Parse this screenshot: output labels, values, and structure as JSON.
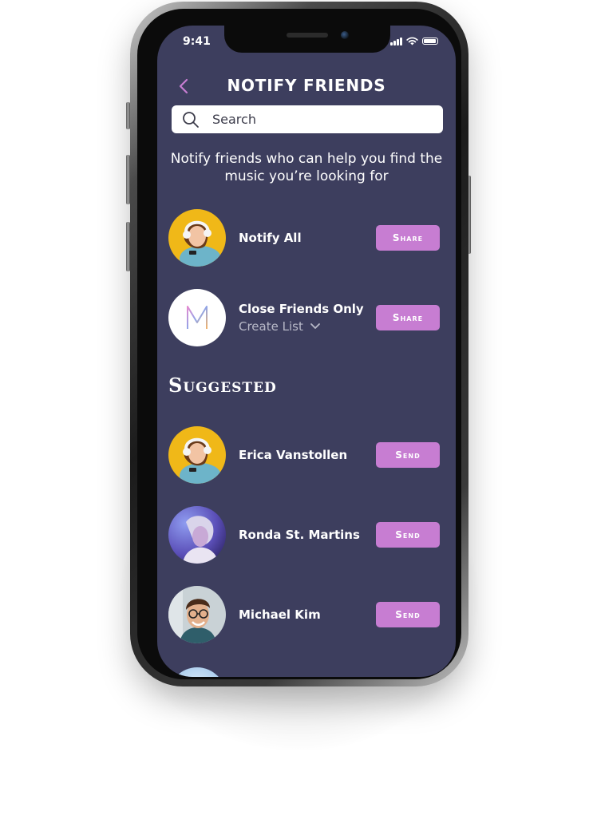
{
  "status_bar": {
    "time": "9:41",
    "icons": [
      "signal-icon",
      "wifi-icon",
      "battery-icon"
    ]
  },
  "header": {
    "title": "NOTIFY FRIENDS",
    "back_icon": "chevron-left-icon"
  },
  "search": {
    "placeholder": "Search",
    "icon": "search-icon"
  },
  "subtitle": "Notify friends who can help you find the music you’re looking for",
  "share_rows": [
    {
      "name": "Notify All",
      "button": "Share",
      "avatar": "woman-with-headphones-yellow"
    },
    {
      "name": "Close Friends Only",
      "sub": "Create List",
      "button": "Share",
      "avatar": "m-logo"
    }
  ],
  "suggested": {
    "title": "Suggested",
    "items": [
      {
        "name": "Erica Vanstollen",
        "button": "Send",
        "avatar": "woman-with-headphones-yellow"
      },
      {
        "name": "Ronda St. Martins",
        "button": "Send",
        "avatar": "woman-purple-light"
      },
      {
        "name": "Michael Kim",
        "button": "Send",
        "avatar": "man-with-glasses"
      }
    ]
  },
  "colors": {
    "screen_bg": "#3d3e5e",
    "accent": "#c77dd2",
    "text": "#ffffff",
    "muted_text": "#b8b9c8"
  }
}
